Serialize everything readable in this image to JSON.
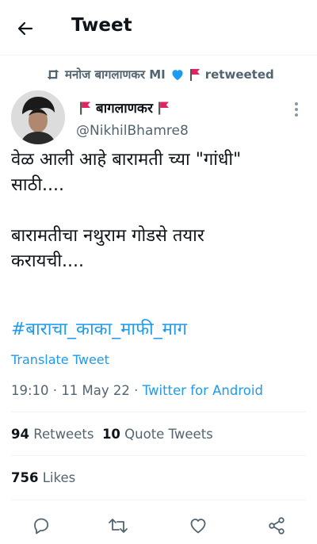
{
  "header": {
    "title": "Tweet",
    "back_icon": "arrow-left-icon"
  },
  "retweet": {
    "user": "मनोज बागलाणकर MI",
    "suffix": "retweeted",
    "heart_color": "#1d9bf0",
    "flag_color": "#e0245e"
  },
  "author": {
    "name": "बागलाणकर",
    "handle": "@NikhilBhamre8",
    "flag_color": "#e0245e"
  },
  "tweet": {
    "text": "वेळ आली आहे बारामती च्या \"गांधी\"\nसाठी....\n\nबारामतीचा नथुराम गोडसे तयार\nकरायची....",
    "hashtag": "#बाराचा_काका_माफी_माग",
    "translate": "Translate Tweet"
  },
  "meta": {
    "time": "19:10",
    "date": "11 May 22",
    "source": "Twitter for Android"
  },
  "stats": {
    "retweets_count": "94",
    "retweets_label": "Retweets",
    "quotes_count": "10",
    "quotes_label": "Quote Tweets",
    "likes_count": "756",
    "likes_label": "Likes"
  },
  "colors": {
    "accent": "#1d9bf0",
    "text": "#0f1419",
    "secondary": "#536471",
    "divider": "#eff3f4"
  }
}
